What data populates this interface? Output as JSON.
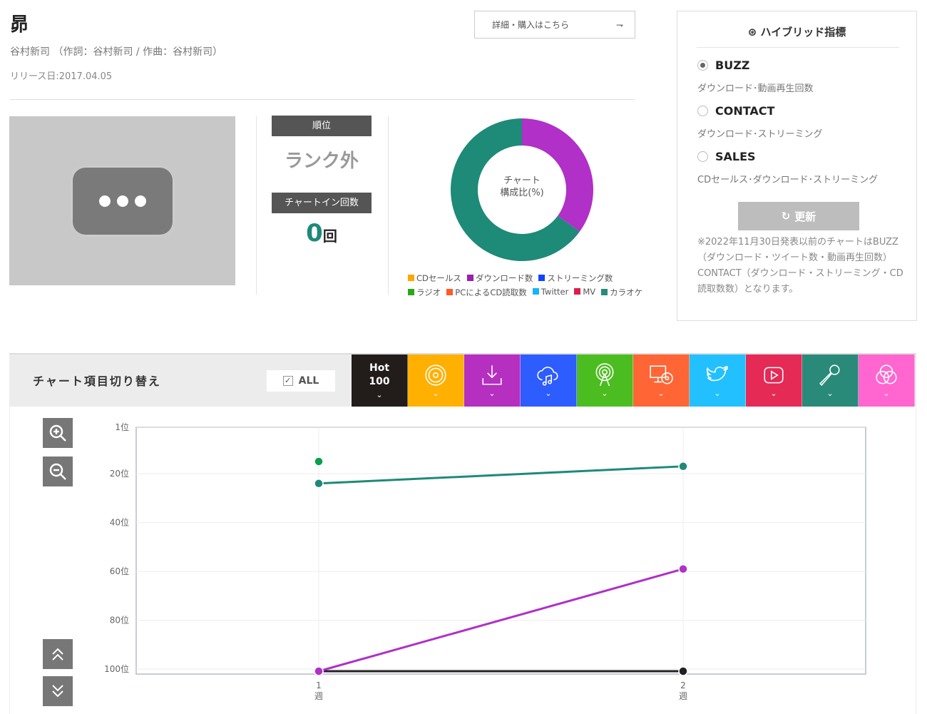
{
  "song": {
    "title": "昴",
    "artist_line": "谷村新司 （作詞：谷村新司 / 作曲：谷村新司）",
    "release": "リリース日:2017.04.05",
    "buy_label": "詳細・購入はこちら",
    "buy_icon": "arrow-icon"
  },
  "stats": {
    "rank_label": "順位",
    "rank_value": "ランク外",
    "count_label": "チャートイン回数",
    "count_value": "0",
    "count_unit": "回"
  },
  "donut": {
    "center": [
      "チャート",
      "構成比(%)"
    ],
    "slices": [
      {
        "name": "ダウンロード数",
        "value": 35,
        "color": "#b030c8"
      },
      {
        "name": "カラオケ",
        "value": 65,
        "color": "#1e8a78"
      }
    ],
    "legend": [
      {
        "label": "CDセールス",
        "color": "#ffa500"
      },
      {
        "label": "ダウンロード数",
        "color": "#9b1fb0"
      },
      {
        "label": "ストリーミング数",
        "color": "#1045ff"
      },
      {
        "label": "ラジオ",
        "color": "#2aa81a"
      },
      {
        "label": "PCによるCD読取数",
        "color": "#ff5a2a"
      },
      {
        "label": "Twitter",
        "color": "#18b4f5"
      },
      {
        "label": "MV",
        "color": "#dc1f4a"
      },
      {
        "label": "カラオケ",
        "color": "#2a8a7a"
      }
    ]
  },
  "hybrid": {
    "title": "ハイブリッド指標",
    "options": [
      {
        "label": "BUZZ",
        "desc": "ダウンロード･動画再生回数",
        "selected": true
      },
      {
        "label": "CONTACT",
        "desc": "ダウンロード･ストリーミング",
        "selected": false
      },
      {
        "label": "SALES",
        "desc": "CDセールス･ダウンロード･ストリーミング",
        "selected": false
      }
    ],
    "refresh_label": "更新",
    "note": "※2022年11月30日発表以前のチャートはBUZZ（ダウンロード・ツイート数・動画再生回数）CONTACT（ダウンロード・ストリーミング・CD読取数数）となります。"
  },
  "switcher": {
    "label": "チャート項目切り替え",
    "all_label": "ALL",
    "tabs": [
      {
        "name": "hot100",
        "text": "Hot 100",
        "color": "#221c1a"
      },
      {
        "name": "cd-sales",
        "icon": "disc-icon",
        "color": "#ffb000"
      },
      {
        "name": "download",
        "icon": "download-icon",
        "color": "#b52fc0"
      },
      {
        "name": "streaming",
        "icon": "cloud-music-icon",
        "color": "#2d5cff"
      },
      {
        "name": "radio",
        "icon": "radio-tower-icon",
        "color": "#4cbd20"
      },
      {
        "name": "pc-cd-read",
        "icon": "pc-disc-icon",
        "color": "#ff6535"
      },
      {
        "name": "twitter",
        "icon": "twitter-icon",
        "color": "#22c0ff"
      },
      {
        "name": "mv",
        "icon": "play-icon",
        "color": "#e42a55"
      },
      {
        "name": "karaoke",
        "icon": "microphone-icon",
        "color": "#2a8a7a"
      },
      {
        "name": "hybrid",
        "icon": "hybrid-icon",
        "color": "#ff66d0"
      }
    ]
  },
  "chart_data": {
    "type": "line",
    "x": [
      "1\n週",
      "2\n週"
    ],
    "x_labels": [
      [
        "1",
        "週"
      ],
      [
        "2",
        "週"
      ]
    ],
    "y_ticks": [
      {
        "v": 1,
        "label": "1位"
      },
      {
        "v": 20,
        "label": "20位"
      },
      {
        "v": 40,
        "label": "40位"
      },
      {
        "v": 60,
        "label": "60位"
      },
      {
        "v": 80,
        "label": "80位"
      },
      {
        "v": 100,
        "label": "100位"
      }
    ],
    "ylim": [
      1,
      102
    ],
    "y_inverted": true,
    "series": [
      {
        "name": "Hot 100",
        "color": "#222222",
        "values": [
          101,
          101
        ]
      },
      {
        "name": "ダウンロード数",
        "color": "#b030c8",
        "values": [
          101,
          59
        ]
      },
      {
        "name": "カラオケ",
        "color": "#1e8a78",
        "values": [
          24,
          17
        ]
      },
      {
        "name": "ラジオ",
        "color": "#0aa04a",
        "values": [
          15,
          null
        ]
      }
    ]
  }
}
